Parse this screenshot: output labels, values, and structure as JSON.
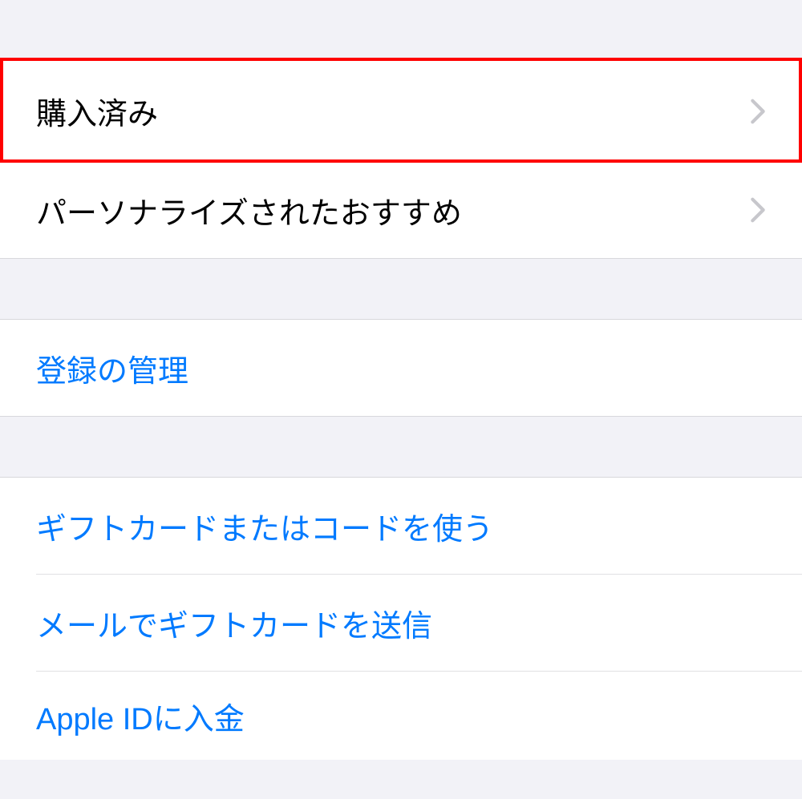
{
  "section1": {
    "items": [
      {
        "label": "購入済み",
        "hasChevron": true,
        "highlighted": true
      },
      {
        "label": "パーソナライズされたおすすめ",
        "hasChevron": true,
        "highlighted": false
      }
    ]
  },
  "section2": {
    "items": [
      {
        "label": "登録の管理"
      }
    ]
  },
  "section3": {
    "items": [
      {
        "label": "ギフトカードまたはコードを使う"
      },
      {
        "label": "メールでギフトカードを送信"
      },
      {
        "label": "Apple IDに入金"
      }
    ]
  }
}
